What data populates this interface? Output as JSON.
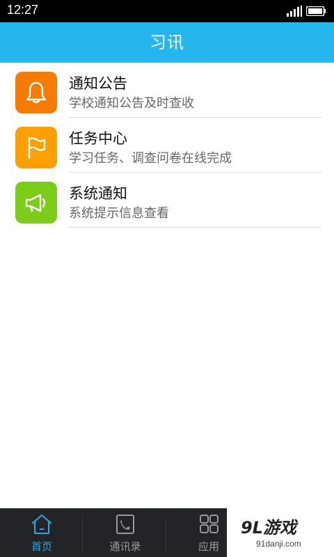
{
  "status_bar": {
    "time": "12:27"
  },
  "header": {
    "title": "习讯"
  },
  "list": [
    {
      "label": "通知公告",
      "subtitle": "学校通知公告及时查收",
      "icon": "bell-icon",
      "color": "#f57c00"
    },
    {
      "label": "任务中心",
      "subtitle": "学习任务、调查问卷在线完成",
      "icon": "flag-icon",
      "color": "#ffa000"
    },
    {
      "label": "系统通知",
      "subtitle": "系统提示信息查看",
      "icon": "megaphone-icon",
      "color": "#7ccd18"
    }
  ],
  "bottom_nav": [
    {
      "label": "首页",
      "icon": "home-icon",
      "active": true
    },
    {
      "label": "通讯录",
      "icon": "contacts-phone-icon",
      "active": false
    },
    {
      "label": "应用",
      "icon": "apps-grid-icon",
      "active": false
    }
  ],
  "watermark": {
    "brand": "9L游戏",
    "site": "91danji.com"
  },
  "colors": {
    "header": "#26b6ee",
    "active_nav": "#27a8e8",
    "nav_bg": "#222428"
  }
}
